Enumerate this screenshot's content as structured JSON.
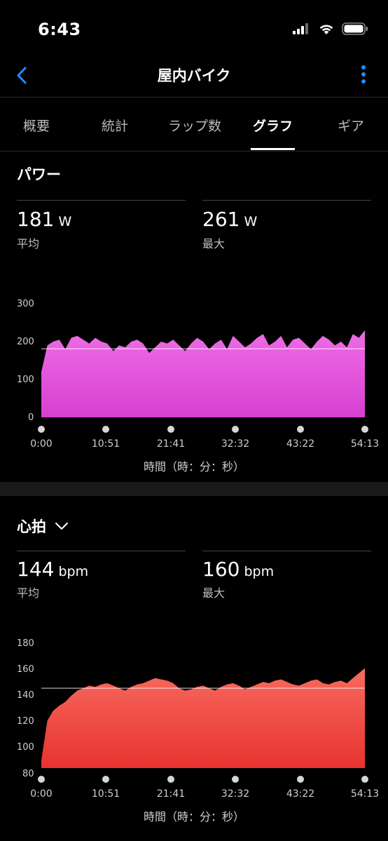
{
  "status": {
    "time": "6:43"
  },
  "nav": {
    "title": "屋内バイク",
    "back_icon": "chevron-left-icon",
    "more_icon": "vertical-ellipsis-icon",
    "accent": "#1e90ff"
  },
  "tabs": [
    {
      "label": "概要",
      "active": false
    },
    {
      "label": "統計",
      "active": false
    },
    {
      "label": "ラップ数",
      "active": false
    },
    {
      "label": "グラフ",
      "active": true
    },
    {
      "label": "ギア",
      "active": false
    }
  ],
  "power": {
    "title": "パワー",
    "avg": {
      "value": "181",
      "unit": "W",
      "label": "平均"
    },
    "max": {
      "value": "261",
      "unit": "W",
      "label": "最大"
    },
    "x_axis_title": "時間（時：分：秒）"
  },
  "heart": {
    "title": "心拍",
    "dropdown_icon": "chevron-down-icon",
    "avg": {
      "value": "144",
      "unit": "bpm",
      "label": "平均"
    },
    "max": {
      "value": "160",
      "unit": "bpm",
      "label": "最大"
    },
    "x_axis_title": "時間（時：分：秒）"
  },
  "chart_data": [
    {
      "type": "area",
      "y_ticks": [
        "300",
        "200",
        "100",
        "0"
      ],
      "x_ticks": [
        "0:00",
        "10:51",
        "21:41",
        "32:32",
        "43:22",
        "54:13"
      ],
      "ylim": [
        0,
        300
      ],
      "average_line": 181,
      "color": "#d83fd0",
      "x": [
        0,
        1,
        2,
        3,
        4,
        5,
        6,
        7,
        8,
        9,
        10,
        11,
        12,
        13,
        14,
        15,
        16,
        17,
        18,
        19,
        20,
        21,
        22,
        23,
        24,
        25,
        26,
        27,
        28,
        29,
        30,
        31,
        32,
        33,
        34,
        35,
        36,
        37,
        38,
        39,
        40,
        41,
        42,
        43,
        44,
        45,
        46,
        47,
        48,
        49,
        50,
        51,
        52,
        53,
        54
      ],
      "values": [
        120,
        190,
        200,
        205,
        180,
        210,
        215,
        205,
        195,
        210,
        200,
        195,
        175,
        190,
        185,
        200,
        205,
        195,
        170,
        185,
        200,
        195,
        205,
        190,
        175,
        195,
        210,
        200,
        180,
        195,
        205,
        180,
        215,
        200,
        185,
        195,
        210,
        220,
        190,
        200,
        215,
        185,
        205,
        210,
        195,
        180,
        200,
        215,
        205,
        190,
        200,
        185,
        220,
        210,
        230
      ]
    },
    {
      "type": "area",
      "y_ticks": [
        "180",
        "160",
        "140",
        "120",
        "100",
        "80"
      ],
      "x_ticks": [
        "0:00",
        "10:51",
        "21:41",
        "32:32",
        "43:22",
        "54:13"
      ],
      "ylim": [
        80,
        180
      ],
      "average_line": 144,
      "color": "#e8332f",
      "x": [
        0,
        1,
        2,
        3,
        4,
        5,
        6,
        7,
        8,
        9,
        10,
        11,
        12,
        13,
        14,
        15,
        16,
        17,
        18,
        19,
        20,
        21,
        22,
        23,
        24,
        25,
        26,
        27,
        28,
        29,
        30,
        31,
        32,
        33,
        34,
        35,
        36,
        37,
        38,
        39,
        40,
        41,
        42,
        43,
        44,
        45,
        46,
        47,
        48,
        49,
        50,
        51,
        52,
        53,
        54
      ],
      "values": [
        86,
        118,
        126,
        130,
        133,
        138,
        142,
        144,
        146,
        145,
        147,
        148,
        146,
        144,
        142,
        145,
        147,
        148,
        150,
        152,
        151,
        150,
        148,
        144,
        142,
        143,
        145,
        146,
        144,
        142,
        145,
        147,
        148,
        146,
        143,
        145,
        147,
        149,
        148,
        150,
        151,
        149,
        147,
        146,
        148,
        150,
        151,
        148,
        147,
        149,
        150,
        148,
        152,
        156,
        160
      ]
    }
  ]
}
